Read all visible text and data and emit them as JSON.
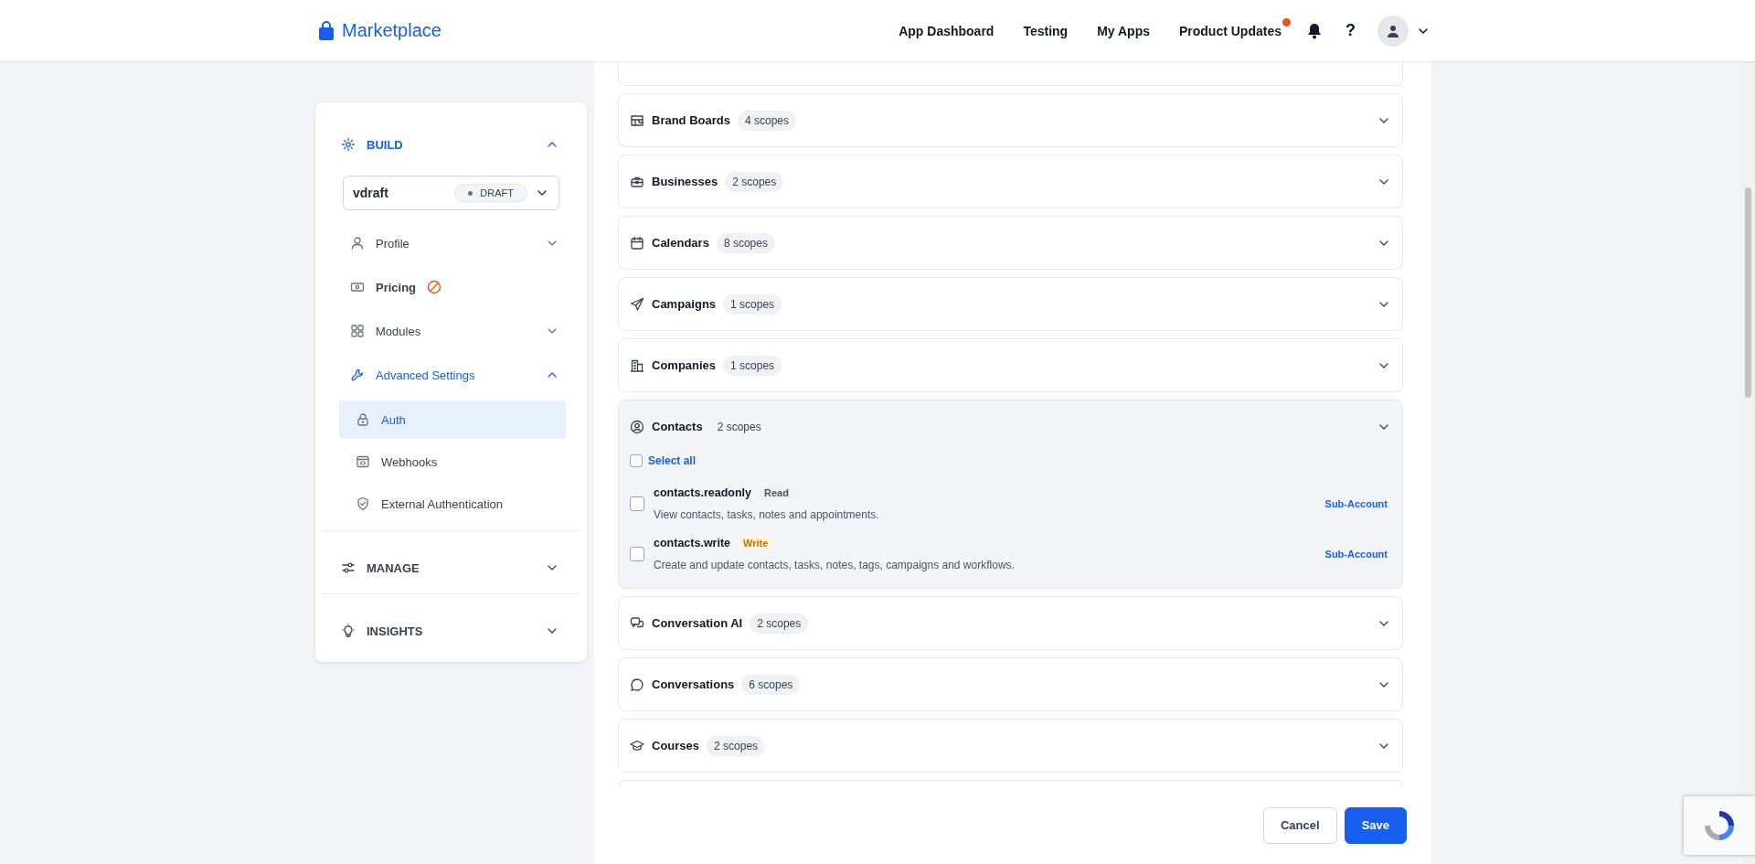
{
  "header": {
    "brand": "Marketplace",
    "nav": [
      {
        "label": "App Dashboard",
        "has_update": false
      },
      {
        "label": "Testing",
        "has_update": false
      },
      {
        "label": "My Apps",
        "has_update": false
      },
      {
        "label": "Product Updates",
        "has_update": true
      }
    ],
    "help": "?"
  },
  "sidebar": {
    "sections": [
      {
        "label": "BUILD",
        "expanded": true,
        "app_select": {
          "value": "vdraft",
          "status": "DRAFT"
        },
        "items": [
          {
            "label": "Profile",
            "expanded": false,
            "flagged": false,
            "active": false
          },
          {
            "label": "Pricing",
            "flagged": true,
            "active": false
          },
          {
            "label": "Modules",
            "expanded": false,
            "flagged": false,
            "active": false
          },
          {
            "label": "Advanced Settings",
            "expanded": true,
            "flagged": false,
            "active": true,
            "children": [
              {
                "label": "Auth",
                "selected": true
              },
              {
                "label": "Webhooks",
                "selected": false
              },
              {
                "label": "External Authentication",
                "selected": false
              }
            ]
          }
        ]
      },
      {
        "label": "MANAGE",
        "expanded": false
      },
      {
        "label": "INSIGHTS",
        "expanded": false
      }
    ]
  },
  "scope_groups": [
    {
      "name": "Brand Boards",
      "count": "4 scopes",
      "expanded": false
    },
    {
      "name": "Businesses",
      "count": "2 scopes",
      "expanded": false
    },
    {
      "name": "Calendars",
      "count": "8 scopes",
      "expanded": false
    },
    {
      "name": "Campaigns",
      "count": "1 scopes",
      "expanded": false
    },
    {
      "name": "Companies",
      "count": "1 scopes",
      "expanded": false
    },
    {
      "name": "Contacts",
      "count": "2 scopes",
      "expanded": true,
      "select_all": {
        "label": "Select all",
        "checked": false
      },
      "scopes": [
        {
          "name": "contacts.readonly",
          "access": "Read",
          "kind": "read",
          "description": "View contacts, tasks, notes and appointments.",
          "level": "Sub-Account",
          "checked": false
        },
        {
          "name": "contacts.write",
          "access": "Write",
          "kind": "write",
          "description": "Create and update contacts, tasks, notes, tags, campaigns and workflows.",
          "level": "Sub-Account",
          "checked": false
        }
      ]
    },
    {
      "name": "Conversation AI",
      "count": "2 scopes",
      "expanded": false
    },
    {
      "name": "Conversations",
      "count": "6 scopes",
      "expanded": false
    },
    {
      "name": "Courses",
      "count": "2 scopes",
      "expanded": false
    }
  ],
  "footer": {
    "buttons": [
      {
        "label": "Cancel",
        "kind": "secondary"
      },
      {
        "label": "Save",
        "kind": "primary"
      }
    ]
  }
}
